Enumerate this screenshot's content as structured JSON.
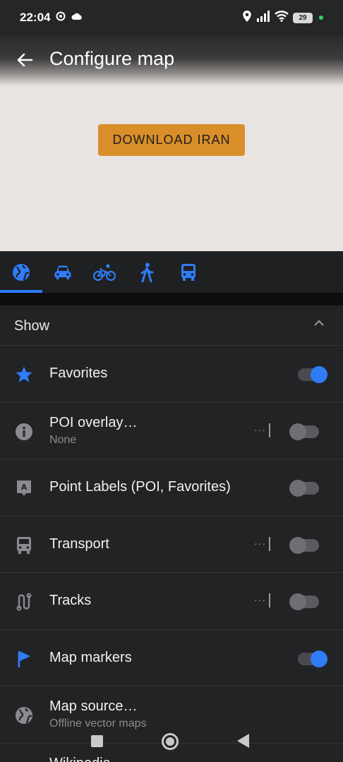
{
  "status_bar": {
    "time": "22:04",
    "battery": "29"
  },
  "header": {
    "title": "Configure map"
  },
  "map": {
    "download_button": "DOWNLOAD IRAN"
  },
  "tabs": [
    {
      "icon": "globe-icon",
      "selected": true
    },
    {
      "icon": "car-icon",
      "selected": false
    },
    {
      "icon": "bicycle-icon",
      "selected": false
    },
    {
      "icon": "pedestrian-icon",
      "selected": false
    },
    {
      "icon": "bus-icon",
      "selected": false
    }
  ],
  "section": {
    "label": "Show"
  },
  "rows": [
    {
      "label": "Favorites",
      "icon": "star-icon",
      "enabled": true
    },
    {
      "label": "POI overlay…",
      "sub": "None",
      "icon": "info-icon",
      "enabled": false,
      "more": "···"
    },
    {
      "label": "Point Labels (POI, Favorites)",
      "icon": "label-icon",
      "enabled": false
    },
    {
      "label": "Transport",
      "icon": "bus-icon",
      "enabled": false,
      "more": "···"
    },
    {
      "label": "Tracks",
      "icon": "tracks-icon",
      "enabled": false,
      "more": "···"
    },
    {
      "label": "Map markers",
      "icon": "flag-icon",
      "enabled": true
    },
    {
      "label": "Map source…",
      "sub": "Offline vector maps",
      "icon": "globe-icon"
    },
    {
      "label": "Wikipedia",
      "icon": "wikipedia-icon"
    }
  ],
  "colors": {
    "accent": "#2f7cf6",
    "download": "#d98e2a",
    "background": "#222325"
  }
}
